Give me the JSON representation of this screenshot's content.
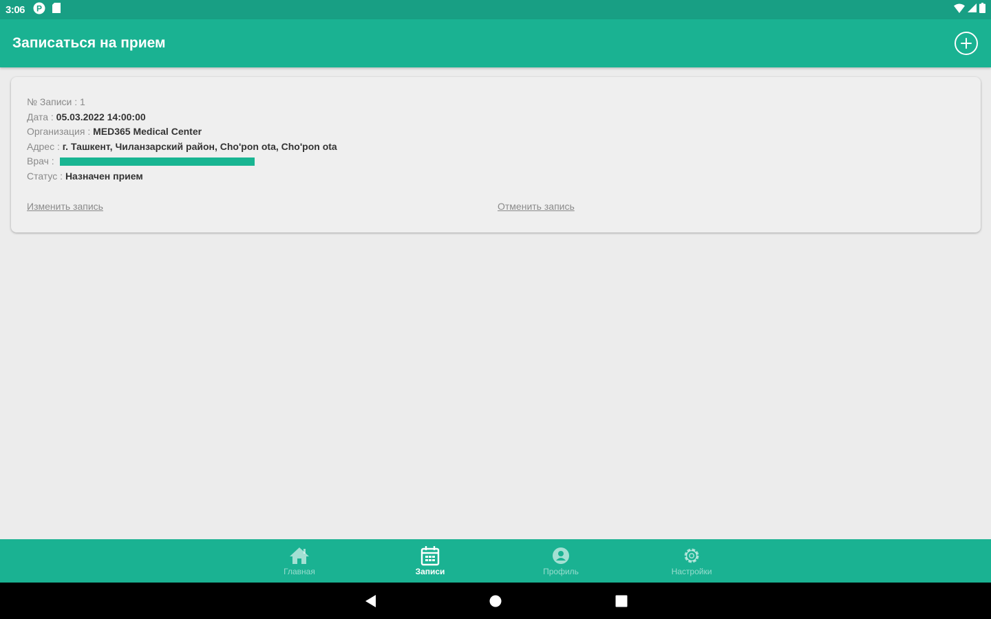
{
  "status_bar": {
    "time": "3:06"
  },
  "app_bar": {
    "title": "Записаться на прием"
  },
  "appointment": {
    "number_label": "№ Записи : ",
    "number_value": "1",
    "date_label": "Дата : ",
    "date_value": "05.03.2022 14:00:00",
    "org_label": "Организация : ",
    "org_value": "MED365 Medical Center",
    "address_label": "Адрес : ",
    "address_value": "г. Ташкент, Чиланзарский район, Cho'pon ota, Cho'pon ota",
    "doctor_label": "Врач : ",
    "status_label": "Статус : ",
    "status_value": "Назначен прием",
    "edit_link": "Изменить запись",
    "cancel_link": "Отменить запись"
  },
  "bottom_nav": {
    "items": [
      {
        "label": "Главная",
        "icon": "home-icon"
      },
      {
        "label": "Записи",
        "icon": "calendar-icon"
      },
      {
        "label": "Профиль",
        "icon": "profile-icon"
      },
      {
        "label": "Настройки",
        "icon": "gear-icon"
      }
    ],
    "active_index": 1
  },
  "colors": {
    "status_bar": "#189f84",
    "app_bar": "#1ab292",
    "background": "#ececec",
    "card": "#efefef",
    "accent": "#19b592"
  }
}
